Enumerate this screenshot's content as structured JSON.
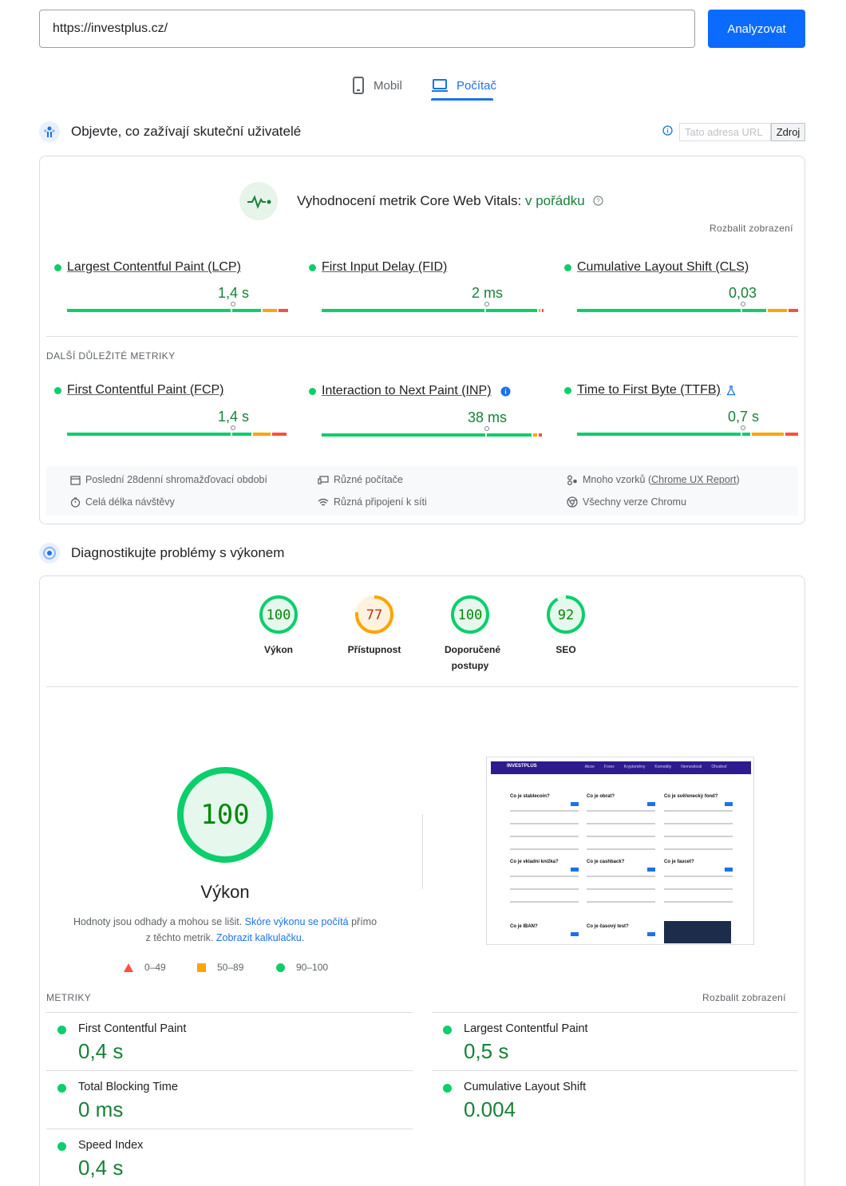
{
  "search": {
    "url": "https://investplus.cz/",
    "button": "Analyzovat"
  },
  "tabs": {
    "mobile": "Mobil",
    "desktop": "Počítač"
  },
  "field": {
    "heading": "Objevte, co zažívají skuteční uživatelé",
    "url_placeholder": "Tato adresa URL",
    "source_button": "Zdroj",
    "cwv_label": "Vyhodnocení metrik Core Web Vitals:",
    "cwv_status": "v pořádku",
    "expand": "Rozbalit zobrazení",
    "core_metrics": [
      {
        "name": "Largest Contentful Paint (LCP)",
        "value": "1,4 s"
      },
      {
        "name": "First Input Delay (FID)",
        "value": "2 ms"
      },
      {
        "name": "Cumulative Layout Shift (CLS)",
        "value": "0,03"
      }
    ],
    "other_label": "DALŠÍ DŮLEŽITÉ METRIKY",
    "other_metrics": [
      {
        "name": "First Contentful Paint (FCP)",
        "value": "1,4 s"
      },
      {
        "name": "Interaction to Next Paint (INP)",
        "value": "38 ms"
      },
      {
        "name": "Time to First Byte (TTFB)",
        "value": "0,7 s"
      }
    ],
    "info": {
      "period": "Poslední 28denní shromažďovací období",
      "devices": "Různé počítače",
      "samples_prefix": "Mnoho vzorků (",
      "samples_link": "Chrome UX Report",
      "samples_suffix": ")",
      "duration": "Celá délka návštěvy",
      "connections": "Různá připojení k síti",
      "chrome": "Všechny verze Chromu"
    }
  },
  "lab": {
    "heading": "Diagnostikujte problémy s výkonem",
    "scores": [
      {
        "value": "100",
        "label": "Výkon",
        "score": 100,
        "color": "#0cce6b",
        "text_color": "#008800",
        "bg": "#e6f8ee"
      },
      {
        "value": "77",
        "label": "Přístupnost",
        "score": 77,
        "color": "#ffa400",
        "text_color": "#c33300",
        "bg": "#fff3e0"
      },
      {
        "value": "100",
        "label": "Doporučené postupy",
        "score": 100,
        "color": "#0cce6b",
        "text_color": "#008800",
        "bg": "#e6f8ee"
      },
      {
        "value": "92",
        "label": "SEO",
        "score": 92,
        "color": "#0cce6b",
        "text_color": "#008800",
        "bg": "#e6f8ee"
      }
    ],
    "big_score": "100",
    "big_title": "Výkon",
    "desc_1": "Hodnoty jsou odhady a mohou se lišit.",
    "desc_link_1": "Skóre výkonu se počítá",
    "desc_2": "přímo",
    "desc_3": "z těchto metrik.",
    "desc_link_2": "Zobrazit kalkulačku.",
    "legend": {
      "bad": "0–49",
      "avg": "50–89",
      "good": "90–100"
    },
    "metrics_label": "METRIKY",
    "expand": "Rozbalit zobrazení",
    "metrics": [
      {
        "name": "First Contentful Paint",
        "value": "0,4 s"
      },
      {
        "name": "Largest Contentful Paint",
        "value": "0,5 s"
      },
      {
        "name": "Total Blocking Time",
        "value": "0 ms"
      },
      {
        "name": "Cumulative Layout Shift",
        "value": "0.004"
      },
      {
        "name": "Speed Index",
        "value": "0,4 s"
      }
    ],
    "thumbnail": {
      "logo": "INVESTPLUS",
      "nav": [
        "Akcie",
        "Forex",
        "Kryptoměny",
        "Komodity",
        "Nemovitosti",
        "Ohodnoť"
      ],
      "cards": [
        "Co je stablecoin?",
        "Co je obrat?",
        "Co je svěřenecký fond?",
        "Co je vkladní knížka?",
        "Co je cashback?",
        "Co je faucet?",
        "Co je IBAN?",
        "Co je časový test?"
      ]
    }
  },
  "colors": {
    "accent": "#1a73e8",
    "good": "#0cce6b",
    "average": "#ffa400",
    "poor": "#ff4e42"
  }
}
